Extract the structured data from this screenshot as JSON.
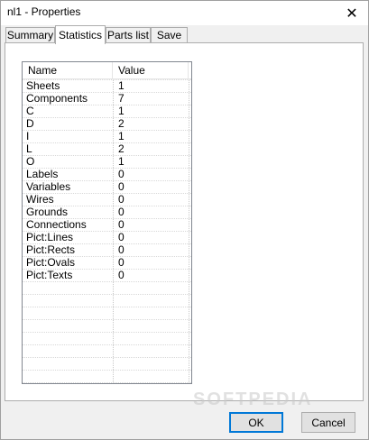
{
  "window": {
    "title": "nl1 - Properties",
    "close_glyph": "✕"
  },
  "tabs": [
    {
      "label": "Summary",
      "active": false
    },
    {
      "label": "Statistics",
      "active": true
    },
    {
      "label": "Parts list",
      "active": false
    },
    {
      "label": "Save",
      "active": false
    }
  ],
  "table": {
    "columns": [
      "Name",
      "Value"
    ],
    "rows": [
      {
        "name": "Sheets",
        "value": "1"
      },
      {
        "name": "Components",
        "value": "7"
      },
      {
        "name": "C",
        "value": "1"
      },
      {
        "name": "D",
        "value": "2"
      },
      {
        "name": "I",
        "value": "1"
      },
      {
        "name": "L",
        "value": "2"
      },
      {
        "name": "O",
        "value": "1"
      },
      {
        "name": "Labels",
        "value": "0"
      },
      {
        "name": "Variables",
        "value": "0"
      },
      {
        "name": "Wires",
        "value": "0"
      },
      {
        "name": "Grounds",
        "value": "0"
      },
      {
        "name": "Connections",
        "value": "0"
      },
      {
        "name": "Pict:Lines",
        "value": "0"
      },
      {
        "name": "Pict:Rects",
        "value": "0"
      },
      {
        "name": "Pict:Ovals",
        "value": "0"
      },
      {
        "name": "Pict:Texts",
        "value": "0"
      }
    ]
  },
  "buttons": {
    "ok": "OK",
    "cancel": "Cancel"
  },
  "watermark": "SOFTPEDIA"
}
